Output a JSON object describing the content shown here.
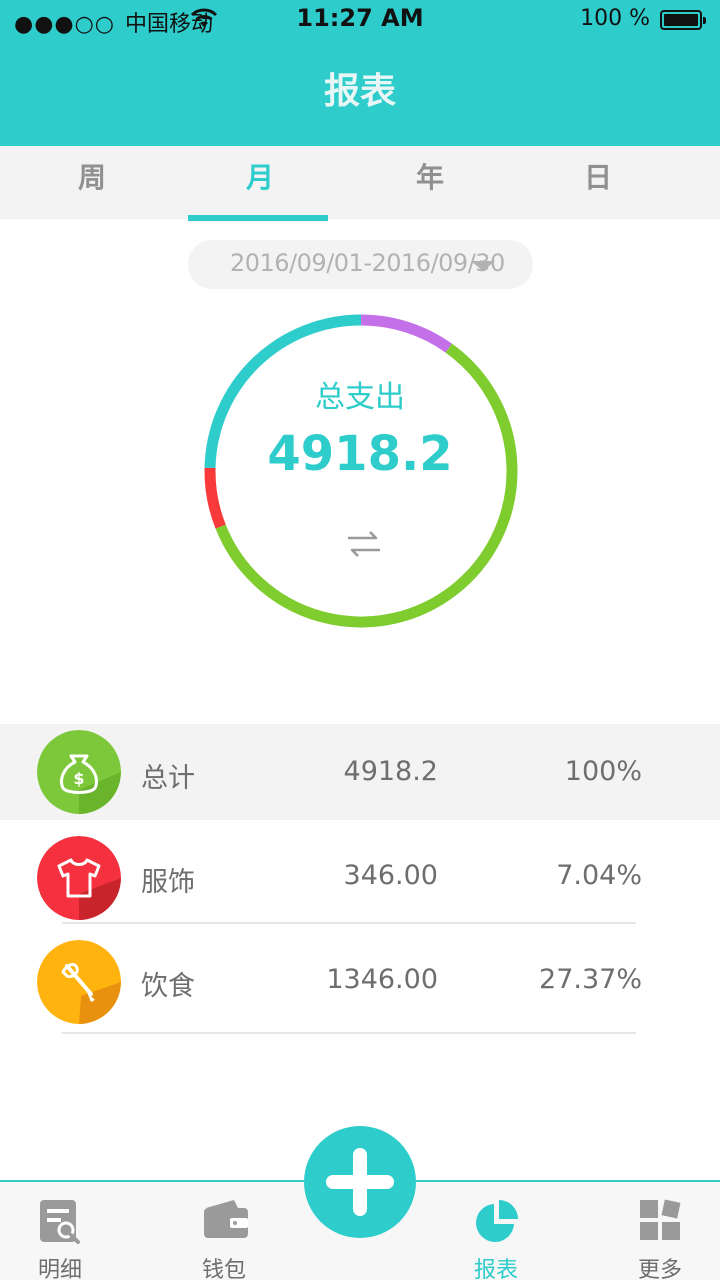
{
  "status_bar": {
    "signal": "●●●○○",
    "carrier": "中国移动",
    "time": "11:27 AM",
    "battery": "100 %"
  },
  "header": {
    "title": "报表"
  },
  "period_tabs": [
    {
      "label": "周",
      "active": false
    },
    {
      "label": "月",
      "active": true
    },
    {
      "label": "年",
      "active": false
    },
    {
      "label": "日",
      "active": false
    }
  ],
  "date_range": "2016/09/01-2016/09/30",
  "summary": {
    "label": "总支出",
    "value": "4918.2"
  },
  "chart_data": {
    "type": "pie",
    "style": "donut",
    "slices": [
      {
        "name": "饮食",
        "value": 1346.0,
        "percent": 27.37,
        "color": "#2ecccb"
      },
      {
        "name": "服饰",
        "value": 346.0,
        "percent": 7.04,
        "color": "#f93a3a"
      },
      {
        "name": "",
        "value": 3226.2,
        "percent": 65.59,
        "color": "#7fcc2e"
      }
    ],
    "extra_arc_color": "#c470e8"
  },
  "categories": {
    "total": {
      "name": "总计",
      "amount": "4918.2",
      "percent": "100%",
      "icon": "money-bag-icon",
      "color": "#7dc83a"
    },
    "rows": [
      {
        "name": "服饰",
        "amount": "346.00",
        "percent": "7.04%",
        "icon": "tshirt-icon",
        "color": "#f5313f"
      },
      {
        "name": "饮食",
        "amount": "1346.00",
        "percent": "27.37%",
        "icon": "food-icon",
        "color": "#ffb30f"
      }
    ]
  },
  "bottom_nav": [
    {
      "label": "明细",
      "icon": "details-icon",
      "active": false
    },
    {
      "label": "钱包",
      "icon": "wallet-icon",
      "active": false
    },
    {
      "label": "报表",
      "icon": "pie-chart-icon",
      "active": true
    },
    {
      "label": "更多",
      "icon": "more-grid-icon",
      "active": false
    }
  ],
  "colors": {
    "accent": "#2ecccb",
    "text": "#6e6e6e",
    "muted": "#919090",
    "date_text": "#b3b2b2"
  }
}
